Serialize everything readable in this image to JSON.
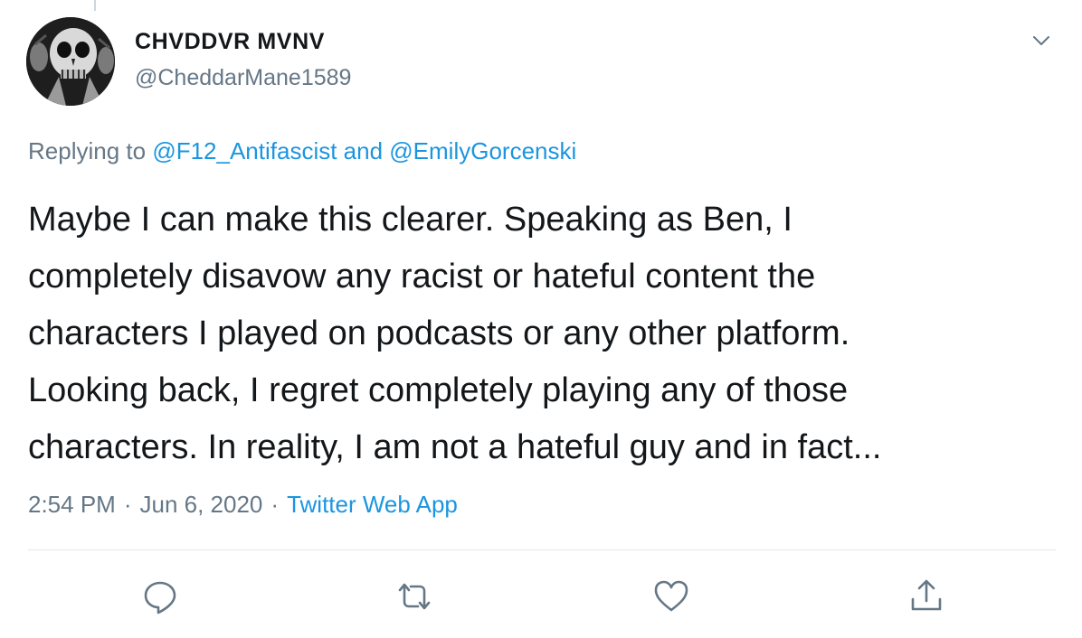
{
  "author": {
    "display_name": "CHVDDVR MVNV",
    "handle": "@CheddarMane1589",
    "avatar_icon": "skull-avatar"
  },
  "replying": {
    "prefix": "Replying to ",
    "mention_1": "@F12_Antifascist",
    "joiner": " and ",
    "mention_2": "@EmilyGorcenski"
  },
  "tweet": {
    "lines": [
      "Maybe I can make this clearer. Speaking as Ben, I",
      "completely disavow any racist or hateful content the",
      "characters I played on podcasts or any other platform.",
      "Looking back, I regret completely playing any of those",
      "characters. In reality, I am not a hateful guy and in fact..."
    ]
  },
  "meta": {
    "time": "2:54 PM",
    "separator": "·",
    "date": "Jun 6, 2020",
    "source": "Twitter Web App"
  },
  "actions": {
    "reply_icon": "speech-bubble-icon",
    "retweet_icon": "retweet-icon",
    "like_icon": "heart-icon",
    "share_icon": "share-icon"
  },
  "colors": {
    "text": "#14171a",
    "secondary": "#657786",
    "link": "#1b95e0",
    "divider": "#e1e8ed"
  }
}
